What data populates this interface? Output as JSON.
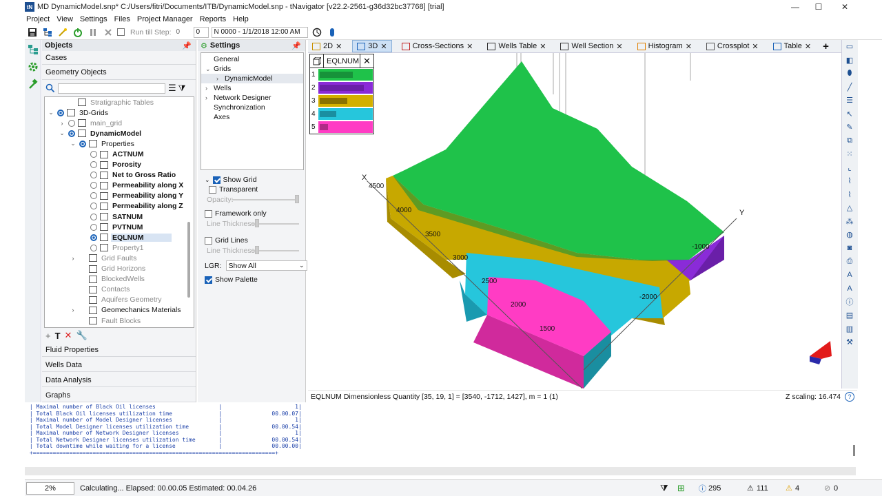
{
  "window": {
    "title": "MD DynamicModel.snp* C:/Users/fitri/Documents/ITB/DynamicModel.snp - tNavigator [v22.2-2561-g36d32bc37768] [trial]",
    "logo_text": "tN",
    "minimize": "—",
    "maximize": "☐",
    "close": "✕"
  },
  "menu": [
    "Project",
    "View",
    "Settings",
    "Files",
    "Project Manager",
    "Reports",
    "Help"
  ],
  "toolbar": {
    "run_till_step_label": "Run till Step:",
    "step_value": "0",
    "step_value2": "0",
    "date_value": "N 0000 - 1/1/2018 12:00 AM"
  },
  "objects_panel": {
    "title": "Objects",
    "cases_label": "Cases",
    "geometry_label": "Geometry Objects",
    "search_placeholder": "",
    "tree": [
      {
        "label": "Stratigraphic Tables",
        "indent": 1,
        "style": "gray",
        "expander": "",
        "radio": "",
        "icon": "table"
      },
      {
        "label": "3D-Grids",
        "indent": 0,
        "style": "",
        "expander": "⌄",
        "radio": "on",
        "icon": "grid"
      },
      {
        "label": "main_grid",
        "indent": 1,
        "style": "gray",
        "expander": "›",
        "radio": "off",
        "icon": "grid"
      },
      {
        "label": "DynamicModel",
        "indent": 1,
        "style": "bold",
        "expander": "⌄",
        "radio": "on",
        "icon": "grid"
      },
      {
        "label": "Properties",
        "indent": 2,
        "style": "",
        "expander": "⌄",
        "radio": "on",
        "icon": "cube"
      },
      {
        "label": "ACTNUM",
        "indent": 3,
        "style": "bold",
        "expander": "",
        "radio": "off",
        "icon": "cube"
      },
      {
        "label": "Porosity",
        "indent": 3,
        "style": "bold",
        "expander": "",
        "radio": "off",
        "icon": "cube"
      },
      {
        "label": "Net to Gross Ratio",
        "indent": 3,
        "style": "bold",
        "expander": "",
        "radio": "off",
        "icon": "cube"
      },
      {
        "label": "Permeability along X",
        "indent": 3,
        "style": "bold",
        "expander": "",
        "radio": "off",
        "icon": "cube"
      },
      {
        "label": "Permeability along Y",
        "indent": 3,
        "style": "bold",
        "expander": "",
        "radio": "off",
        "icon": "cube"
      },
      {
        "label": "Permeability along Z",
        "indent": 3,
        "style": "bold",
        "expander": "",
        "radio": "off",
        "icon": "cube"
      },
      {
        "label": "SATNUM",
        "indent": 3,
        "style": "bold",
        "expander": "",
        "radio": "off",
        "icon": "cube"
      },
      {
        "label": "PVTNUM",
        "indent": 3,
        "style": "bold",
        "expander": "",
        "radio": "off",
        "icon": "cube"
      },
      {
        "label": "EQLNUM",
        "indent": 3,
        "style": "bold sel",
        "expander": "",
        "radio": "on",
        "icon": "cube"
      },
      {
        "label": "Property1",
        "indent": 3,
        "style": "gray",
        "expander": "",
        "radio": "off",
        "icon": "cube"
      },
      {
        "label": "Grid Faults",
        "indent": 2,
        "style": "gray",
        "expander": "›",
        "radio": "",
        "icon": "faults"
      },
      {
        "label": "Grid Horizons",
        "indent": 2,
        "style": "gray",
        "expander": "",
        "radio": "",
        "icon": "horizons"
      },
      {
        "label": "BlockedWells",
        "indent": 2,
        "style": "gray",
        "expander": "",
        "radio": "",
        "icon": "wells"
      },
      {
        "label": "Contacts",
        "indent": 2,
        "style": "gray",
        "expander": "",
        "radio": "",
        "icon": "contacts"
      },
      {
        "label": "Aquifers Geometry",
        "indent": 2,
        "style": "gray",
        "expander": "",
        "radio": "",
        "icon": "aquifer"
      },
      {
        "label": "Geomechanics Materials",
        "indent": 2,
        "style": "",
        "expander": "›",
        "radio": "",
        "icon": "geomech"
      },
      {
        "label": "Fault Blocks",
        "indent": 2,
        "style": "gray",
        "expander": "",
        "radio": "",
        "icon": "blocks"
      }
    ],
    "sections": [
      "Fluid Properties",
      "Wells Data",
      "Data Analysis",
      "Graphs"
    ]
  },
  "settings_panel": {
    "title": "Settings",
    "tree": [
      {
        "label": "General",
        "indent": 0,
        "expander": ""
      },
      {
        "label": "Grids",
        "indent": 0,
        "expander": "⌄"
      },
      {
        "label": "DynamicModel",
        "indent": 1,
        "expander": "›",
        "selected": true
      },
      {
        "label": "Wells",
        "indent": 0,
        "expander": "›"
      },
      {
        "label": "Network Designer",
        "indent": 0,
        "expander": "›"
      },
      {
        "label": "Synchronization",
        "indent": 0,
        "expander": ""
      },
      {
        "label": "Axes",
        "indent": 0,
        "expander": ""
      }
    ],
    "show_grid": "Show Grid",
    "transparent": "Transparent",
    "opacity": "Opacity:",
    "framework_only": "Framework only",
    "line_thickness": "Line Thickness:",
    "grid_lines": "Grid Lines",
    "line_thickness2": "Line Thickness:",
    "lgr_label": "LGR:",
    "lgr_value": "Show All",
    "show_palette": "Show Palette"
  },
  "tabs": [
    {
      "label": "2D",
      "icon": "2d"
    },
    {
      "label": "3D",
      "icon": "3d",
      "active": true
    },
    {
      "label": "Cross-Sections",
      "icon": "xs"
    },
    {
      "label": "Wells Table",
      "icon": "wt"
    },
    {
      "label": "Well Section",
      "icon": "ws"
    },
    {
      "label": "Histogram",
      "icon": "hist"
    },
    {
      "label": "Crossplot",
      "icon": "cp"
    },
    {
      "label": "Table",
      "icon": "tbl"
    }
  ],
  "tab_add": "+",
  "legend": {
    "title": "EQLNUM",
    "close": "✕",
    "entries": [
      {
        "label": "1",
        "color": "#1fc24a",
        "dark": "#17923a",
        "level": 0.6
      },
      {
        "label": "2",
        "color": "#8a2bd8",
        "dark": "#6a1fa8",
        "level": 0.8
      },
      {
        "label": "3",
        "color": "#d4b000",
        "dark": "#8a7200",
        "level": 0.5
      },
      {
        "label": "4",
        "color": "#26c6dc",
        "dark": "#1a8ea0",
        "level": 0.3
      },
      {
        "label": "5",
        "color": "#ff3cc4",
        "dark": "#b02a88",
        "level": 0.15
      }
    ]
  },
  "viewport_labels": {
    "x_axis": "X",
    "y_axis": "Y",
    "x_ticks": [
      "4500",
      "4000",
      "3500",
      "3000",
      "2500",
      "2000",
      "1500"
    ],
    "y_ticks": [
      "-1000",
      "-2000"
    ]
  },
  "viewport_status": {
    "text": "EQLNUM Dimensionless Quantity [35, 19, 1] = [3540, -1712, 1427], m = 1 (1)",
    "zscale": "Z scaling: 16.474",
    "help": "?"
  },
  "log_lines": [
    " | Maximal number of Black Oil licenses                   |                      1|",
    " | Total Black Oil licenses utilization time              |               00.00.07|",
    " | Maximal number of Model Designer licenses              |                      1|",
    " | Total Model Designer licenses utilization time         |               00.00.54|",
    " | Maximal number of Network Designer licenses            |                      1|",
    " | Total Network Designer licenses utilization time       |               00.00.54|",
    " | Total downtime while waiting for a license             |               00.00.00|",
    " +=========================================================================+"
  ],
  "statusbar": {
    "progress": "2%",
    "message": "Calculating... Elapsed: 00.00.05 Estimated: 00.04.26",
    "count1": "295",
    "count2": "111",
    "count3": "4",
    "count4": "0"
  },
  "colors": {
    "green": "#1fc24a",
    "purple": "#8a2bd8",
    "gold": "#d4b000",
    "cyan": "#26c6dc",
    "pink": "#ff3cc4",
    "accent": "#1a62b8"
  }
}
